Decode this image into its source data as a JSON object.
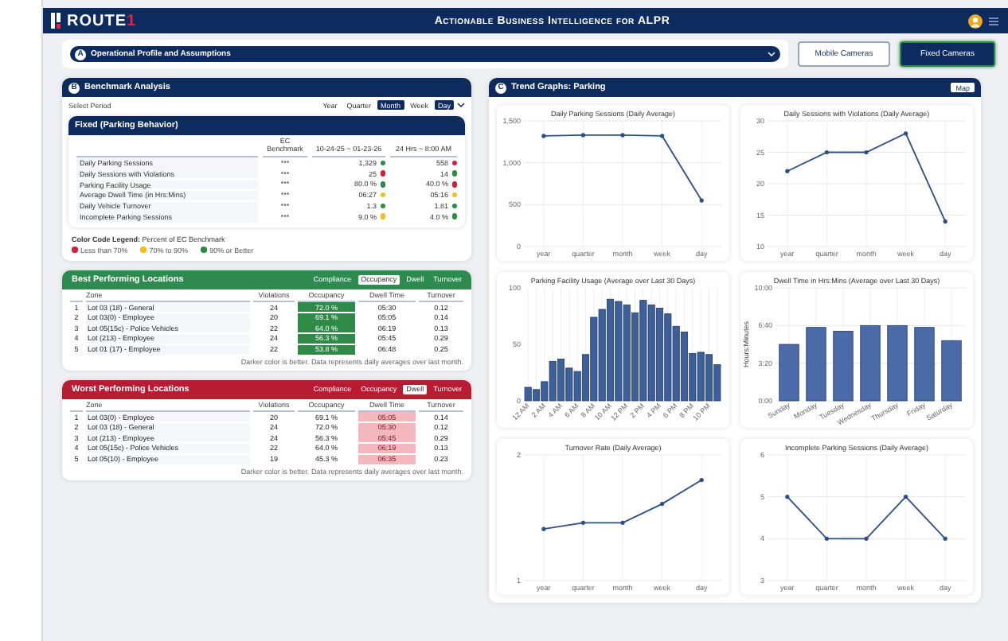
{
  "header": {
    "logo": "ROUTE",
    "logo_accent": "1",
    "title": "Actionable Business Intelligence for ALPR"
  },
  "profile": {
    "letter": "A",
    "label": "Operational Profile and Assumptions",
    "expanded": false
  },
  "camera_tabs": [
    {
      "label": "Mobile Cameras",
      "selected": false
    },
    {
      "label": "Fixed Cameras",
      "selected": true
    }
  ],
  "benchmark": {
    "letter": "B",
    "title": "Benchmark Analysis",
    "period_label": "Select Period",
    "periods": [
      {
        "label": "Year",
        "selected": false
      },
      {
        "label": "Quarter",
        "selected": false
      },
      {
        "label": "Month",
        "selected": true
      },
      {
        "label": "Week",
        "selected": false
      },
      {
        "label": "Day",
        "selected": true
      }
    ],
    "table": {
      "title": "Fixed (Parking Behavior)",
      "columns": [
        "EC Benchmark",
        "10-24-25 ~ 01-23-26",
        "24 Hrs ~ 8:00 AM"
      ],
      "rows": [
        {
          "label": "Daily Parking Sessions",
          "benchmark": "***",
          "values": [
            {
              "text": "1,329",
              "color": "#2e8b46"
            },
            {
              "text": "558",
              "color": "#d0203a"
            }
          ]
        },
        {
          "label": "Daily Sessions with Violations",
          "benchmark": "***",
          "values": [
            {
              "text": "25",
              "color": "#d0203a"
            },
            {
              "text": "14",
              "color": "#2e8b46"
            }
          ]
        },
        {
          "label": "Parking Facility Usage",
          "benchmark": "***",
          "values": [
            {
              "text": "80.0 %",
              "color": "#2e8b46"
            },
            {
              "text": "40.0 %",
              "color": "#d0203a"
            }
          ]
        },
        {
          "label": "Average Dwell Time (in Hrs:Mins)",
          "benchmark": "***",
          "values": [
            {
              "text": "06:27",
              "color": "#f2c01e"
            },
            {
              "text": "05:16",
              "color": "#f2c01e"
            }
          ]
        },
        {
          "label": "Daily Vehicle Turnover",
          "benchmark": "***",
          "values": [
            {
              "text": "1.3",
              "color": "#2e8b46"
            },
            {
              "text": "1.81",
              "color": "#2e8b46"
            }
          ]
        },
        {
          "label": "Incomplete Parking Sessions",
          "benchmark": "***",
          "values": [
            {
              "text": "9.0 %",
              "color": "#f2c01e"
            },
            {
              "text": "4.0 %",
              "color": "#2e8b46"
            }
          ]
        }
      ]
    },
    "legend": {
      "title": "Color Code Legend:",
      "subtitle": "Percent of EC Benchmark",
      "items": [
        {
          "label": "Less than 70%",
          "color": "#d0203a"
        },
        {
          "label": "70% to 90%",
          "color": "#f2c01e"
        },
        {
          "label": "90% or Better",
          "color": "#2e8b46"
        }
      ]
    }
  },
  "best": {
    "title": "Best Performing Locations",
    "color": "#2e8b4f",
    "tabs": [
      {
        "label": "Compliance",
        "selected": false
      },
      {
        "label": "Occupancy",
        "selected": true
      },
      {
        "label": "Dwell",
        "selected": false
      },
      {
        "label": "Turnover",
        "selected": false
      }
    ],
    "columns": [
      "Zone",
      "Violations",
      "Occupancy",
      "Dwell Time",
      "Turnover"
    ],
    "rows": [
      {
        "rank": "1",
        "zone": "Lot 03 (18) - General",
        "violations": "24",
        "occupancy": "72.0 %",
        "dwell": "05:30",
        "turnover": "0.12"
      },
      {
        "rank": "2",
        "zone": "Lot 03(0) - Employee",
        "violations": "20",
        "occupancy": "69.1 %",
        "dwell": "05:05",
        "turnover": "0.14"
      },
      {
        "rank": "3",
        "zone": "Lot 05(15c) - Police Vehicles",
        "violations": "22",
        "occupancy": "64.0 %",
        "dwell": "06:19",
        "turnover": "0.13"
      },
      {
        "rank": "4",
        "zone": "Lot (213) - Employee",
        "violations": "24",
        "occupancy": "56.3 %",
        "dwell": "05:45",
        "turnover": "0.29"
      },
      {
        "rank": "5",
        "zone": "Lot 01 (17) - Employee",
        "violations": "22",
        "occupancy": "53.8 %",
        "dwell": "06:48",
        "turnover": "0.25"
      }
    ],
    "note": "Darker color is better. Data represents daily averages over last month."
  },
  "worst": {
    "title": "Worst Performing Locations",
    "color": "#b71c32",
    "tabs": [
      {
        "label": "Compliance",
        "selected": false
      },
      {
        "label": "Occupancy",
        "selected": false
      },
      {
        "label": "Dwell",
        "selected": true
      },
      {
        "label": "Turnover",
        "selected": false
      }
    ],
    "columns": [
      "Zone",
      "Violations",
      "Occupancy",
      "Dwell Time",
      "Turnover"
    ],
    "rows": [
      {
        "rank": "1",
        "zone": "Lot 03(0) - Employee",
        "violations": "20",
        "occupancy": "69.1 %",
        "dwell": "05:05",
        "turnover": "0.14"
      },
      {
        "rank": "2",
        "zone": "Lot 03 (18) - General",
        "violations": "24",
        "occupancy": "72.0 %",
        "dwell": "05:30",
        "turnover": "0.12"
      },
      {
        "rank": "3",
        "zone": "Lot (213) - Employee",
        "violations": "24",
        "occupancy": "56.3 %",
        "dwell": "05:45",
        "turnover": "0.29"
      },
      {
        "rank": "4",
        "zone": "Lot 05(15c) - Police Vehicles",
        "violations": "22",
        "occupancy": "64.0 %",
        "dwell": "06:19",
        "turnover": "0.13"
      },
      {
        "rank": "5",
        "zone": "Lot 05(10) - Employee",
        "violations": "19",
        "occupancy": "45.3 %",
        "dwell": "06:35",
        "turnover": "0.23"
      }
    ],
    "note": "Darker color is better. Data represents daily averages over last month."
  },
  "trend": {
    "letter": "C",
    "title": "Trend Graphs: Parking",
    "map_button": "Map",
    "charts": [
      {
        "chart_data": {
          "type": "line",
          "title": "Daily Parking Sessions (Daily Average)",
          "grid": true,
          "categories": [
            "year",
            "quarter",
            "month",
            "week",
            "day"
          ],
          "series": [
            {
              "color": "#2b4f86",
              "values": [
                1320,
                1330,
                1330,
                1320,
                550
              ]
            }
          ],
          "ylim": [
            0,
            1500
          ],
          "yticks": [
            0,
            {
              "value": 500,
              "label": "500"
            },
            {
              "value": 1000,
              "label": "1,000"
            },
            {
              "value": 1500,
              "label": "1,500"
            }
          ]
        }
      },
      {
        "chart_data": {
          "type": "line",
          "title": "Daily Sessions with Violations (Daily Average)",
          "grid": true,
          "categories": [
            "year",
            "quarter",
            "month",
            "week",
            "day"
          ],
          "series": [
            {
              "color": "#2b4f86",
              "values": [
                22,
                25,
                25,
                28,
                14
              ]
            }
          ],
          "ylim": [
            10,
            30
          ],
          "yticks": [
            10,
            15,
            20,
            25,
            30
          ]
        }
      },
      {
        "chart_data": {
          "type": "bar",
          "title": "Parking Facility Usage (Average over Last 30 Days)",
          "grid": true,
          "categories": [
            "12 AM",
            null,
            "2 AM",
            null,
            "4 AM",
            null,
            "6 AM",
            null,
            "8 AM",
            null,
            "10 AM",
            null,
            "12 PM",
            null,
            "2 PM",
            null,
            "4 PM",
            null,
            "6 PM",
            null,
            "8 PM",
            null,
            "10 PM",
            null
          ],
          "series": [
            {
              "color": "#3d5f9a",
              "values": [
                12,
                10,
                17,
                35,
                37,
                29,
                26,
                41,
                74,
                81,
                90,
                88,
                85,
                78,
                89,
                85,
                82,
                77,
                66,
                61,
                42,
                43,
                41,
                32
              ]
            }
          ],
          "ylim": [
            0,
            100
          ],
          "yticks": [
            0,
            50,
            100
          ]
        }
      },
      {
        "chart_data": {
          "type": "bar",
          "title": "Dwell Time in Hrs:Mins (Average over Last 30 Days)",
          "grid": true,
          "ylabel": "Hours:Minutes",
          "categories": [
            "Sunday",
            "Monday",
            "Tuesday",
            "Wednesday",
            "Thursday",
            "Friday",
            "Saturday"
          ],
          "series": [
            {
              "color": "#4a6aa8",
              "values": [
                300,
                390,
                370,
                400,
                400,
                390,
                320
              ]
            }
          ],
          "ylim": [
            0,
            600
          ],
          "yticks": [
            {
              "value": 0,
              "label": "0:00"
            },
            {
              "value": 200,
              "label": "3:20"
            },
            {
              "value": 400,
              "label": "6:40"
            },
            {
              "value": 600,
              "label": "10:00"
            }
          ]
        }
      },
      {
        "chart_data": {
          "type": "line",
          "title": "Turnover Rate (Daily Average)",
          "grid": true,
          "categories": [
            "year",
            "quarter",
            "month",
            "week",
            "day"
          ],
          "series": [
            {
              "color": "#2b4f86",
              "values": [
                1.41,
                1.46,
                1.46,
                1.61,
                1.8
              ]
            }
          ],
          "ylim": [
            1,
            2
          ],
          "yticks": [
            1,
            2
          ]
        }
      },
      {
        "chart_data": {
          "type": "line",
          "title": "Incomplete Parking Sessions (Daily Average)",
          "grid": true,
          "categories": [
            "year",
            "quarter",
            "month",
            "week",
            "day"
          ],
          "series": [
            {
              "color": "#2b4f86",
              "values": [
                5,
                4,
                4,
                5,
                4
              ]
            }
          ],
          "ylim": [
            3,
            6
          ],
          "yticks": [
            3,
            4,
            5,
            6
          ]
        }
      }
    ]
  }
}
